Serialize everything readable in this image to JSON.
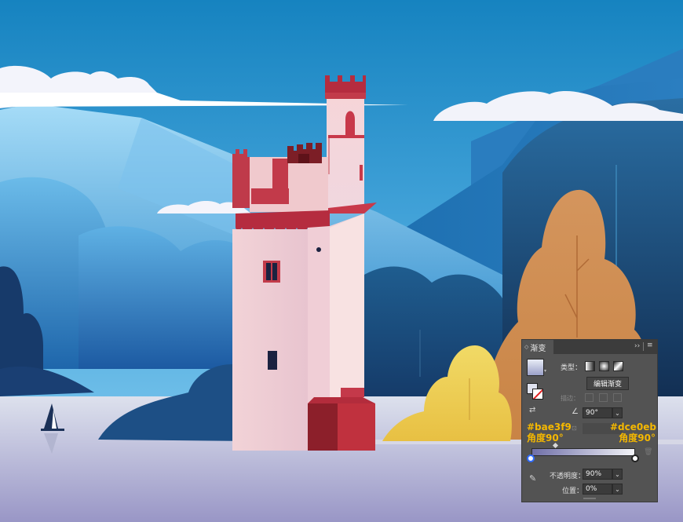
{
  "panel": {
    "tab_label": "渐变",
    "collapse_icon": "double-chevron-right-icon",
    "menu_icon": "hamburger-menu-icon",
    "type_label": "类型：",
    "stroke_label": "描边：",
    "edit_gradient_label": "编辑渐变",
    "angle_value": "90°",
    "opacity_label": "不透明度：",
    "opacity_value": "90%",
    "position_label": "位置：",
    "position_value": "0%"
  },
  "annotations": {
    "left_color": "#bae3f9",
    "left_angle": "角度90°",
    "right_color": "#dce0eb",
    "right_angle": "角度90°"
  },
  "gradient": {
    "start_color": "#bae3f9",
    "end_color": "#dce0eb"
  },
  "colors": {
    "annotation_text": "#f5b800",
    "panel_bg": "#535353",
    "sky_top": "#1a86c2",
    "tower_red": "#a82b35"
  }
}
